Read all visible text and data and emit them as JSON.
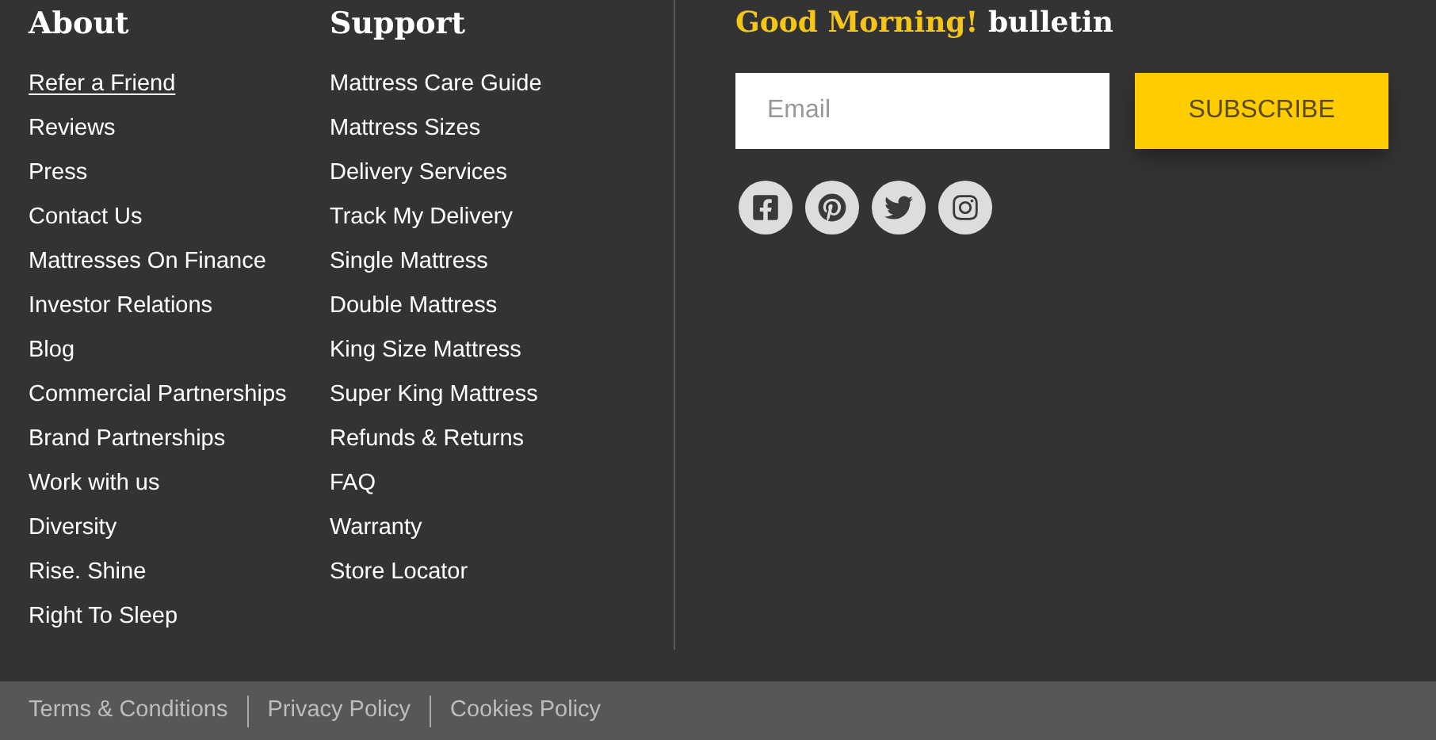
{
  "columns": [
    {
      "heading": "About",
      "links": [
        {
          "label": "Refer a Friend",
          "underlined": true
        },
        {
          "label": "Reviews",
          "underlined": false
        },
        {
          "label": "Press",
          "underlined": false
        },
        {
          "label": "Contact Us",
          "underlined": false
        },
        {
          "label": "Mattresses On Finance",
          "underlined": false
        },
        {
          "label": "Investor Relations",
          "underlined": false
        },
        {
          "label": "Blog",
          "underlined": false
        },
        {
          "label": "Commercial Partnerships",
          "underlined": false
        },
        {
          "label": "Brand Partnerships",
          "underlined": false
        },
        {
          "label": "Work with us",
          "underlined": false
        },
        {
          "label": "Diversity",
          "underlined": false
        },
        {
          "label": "Rise. Shine",
          "underlined": false
        },
        {
          "label": "Right To Sleep",
          "underlined": false
        }
      ]
    },
    {
      "heading": "Support",
      "links": [
        {
          "label": "Mattress Care Guide",
          "underlined": false
        },
        {
          "label": "Mattress Sizes",
          "underlined": false
        },
        {
          "label": "Delivery Services",
          "underlined": false
        },
        {
          "label": "Track My Delivery",
          "underlined": false
        },
        {
          "label": "Single Mattress",
          "underlined": false
        },
        {
          "label": "Double Mattress",
          "underlined": false
        },
        {
          "label": "King Size Mattress",
          "underlined": false
        },
        {
          "label": "Super King Mattress",
          "underlined": false
        },
        {
          "label": "Refunds & Returns",
          "underlined": false
        },
        {
          "label": "FAQ",
          "underlined": false
        },
        {
          "label": "Warranty",
          "underlined": false
        },
        {
          "label": "Store Locator",
          "underlined": false
        }
      ]
    }
  ],
  "newsletter": {
    "title_highlight": "Good Morning!",
    "title_rest": "bulletin",
    "email": {
      "placeholder": "Email"
    },
    "button": "SUBSCRIBE",
    "social": [
      {
        "kind": "facebook"
      },
      {
        "kind": "pinterest"
      },
      {
        "kind": "twitter"
      },
      {
        "kind": "instagram"
      }
    ]
  },
  "legal_links": [
    "Terms & Conditions",
    "Privacy Policy",
    "Cookies Policy"
  ]
}
